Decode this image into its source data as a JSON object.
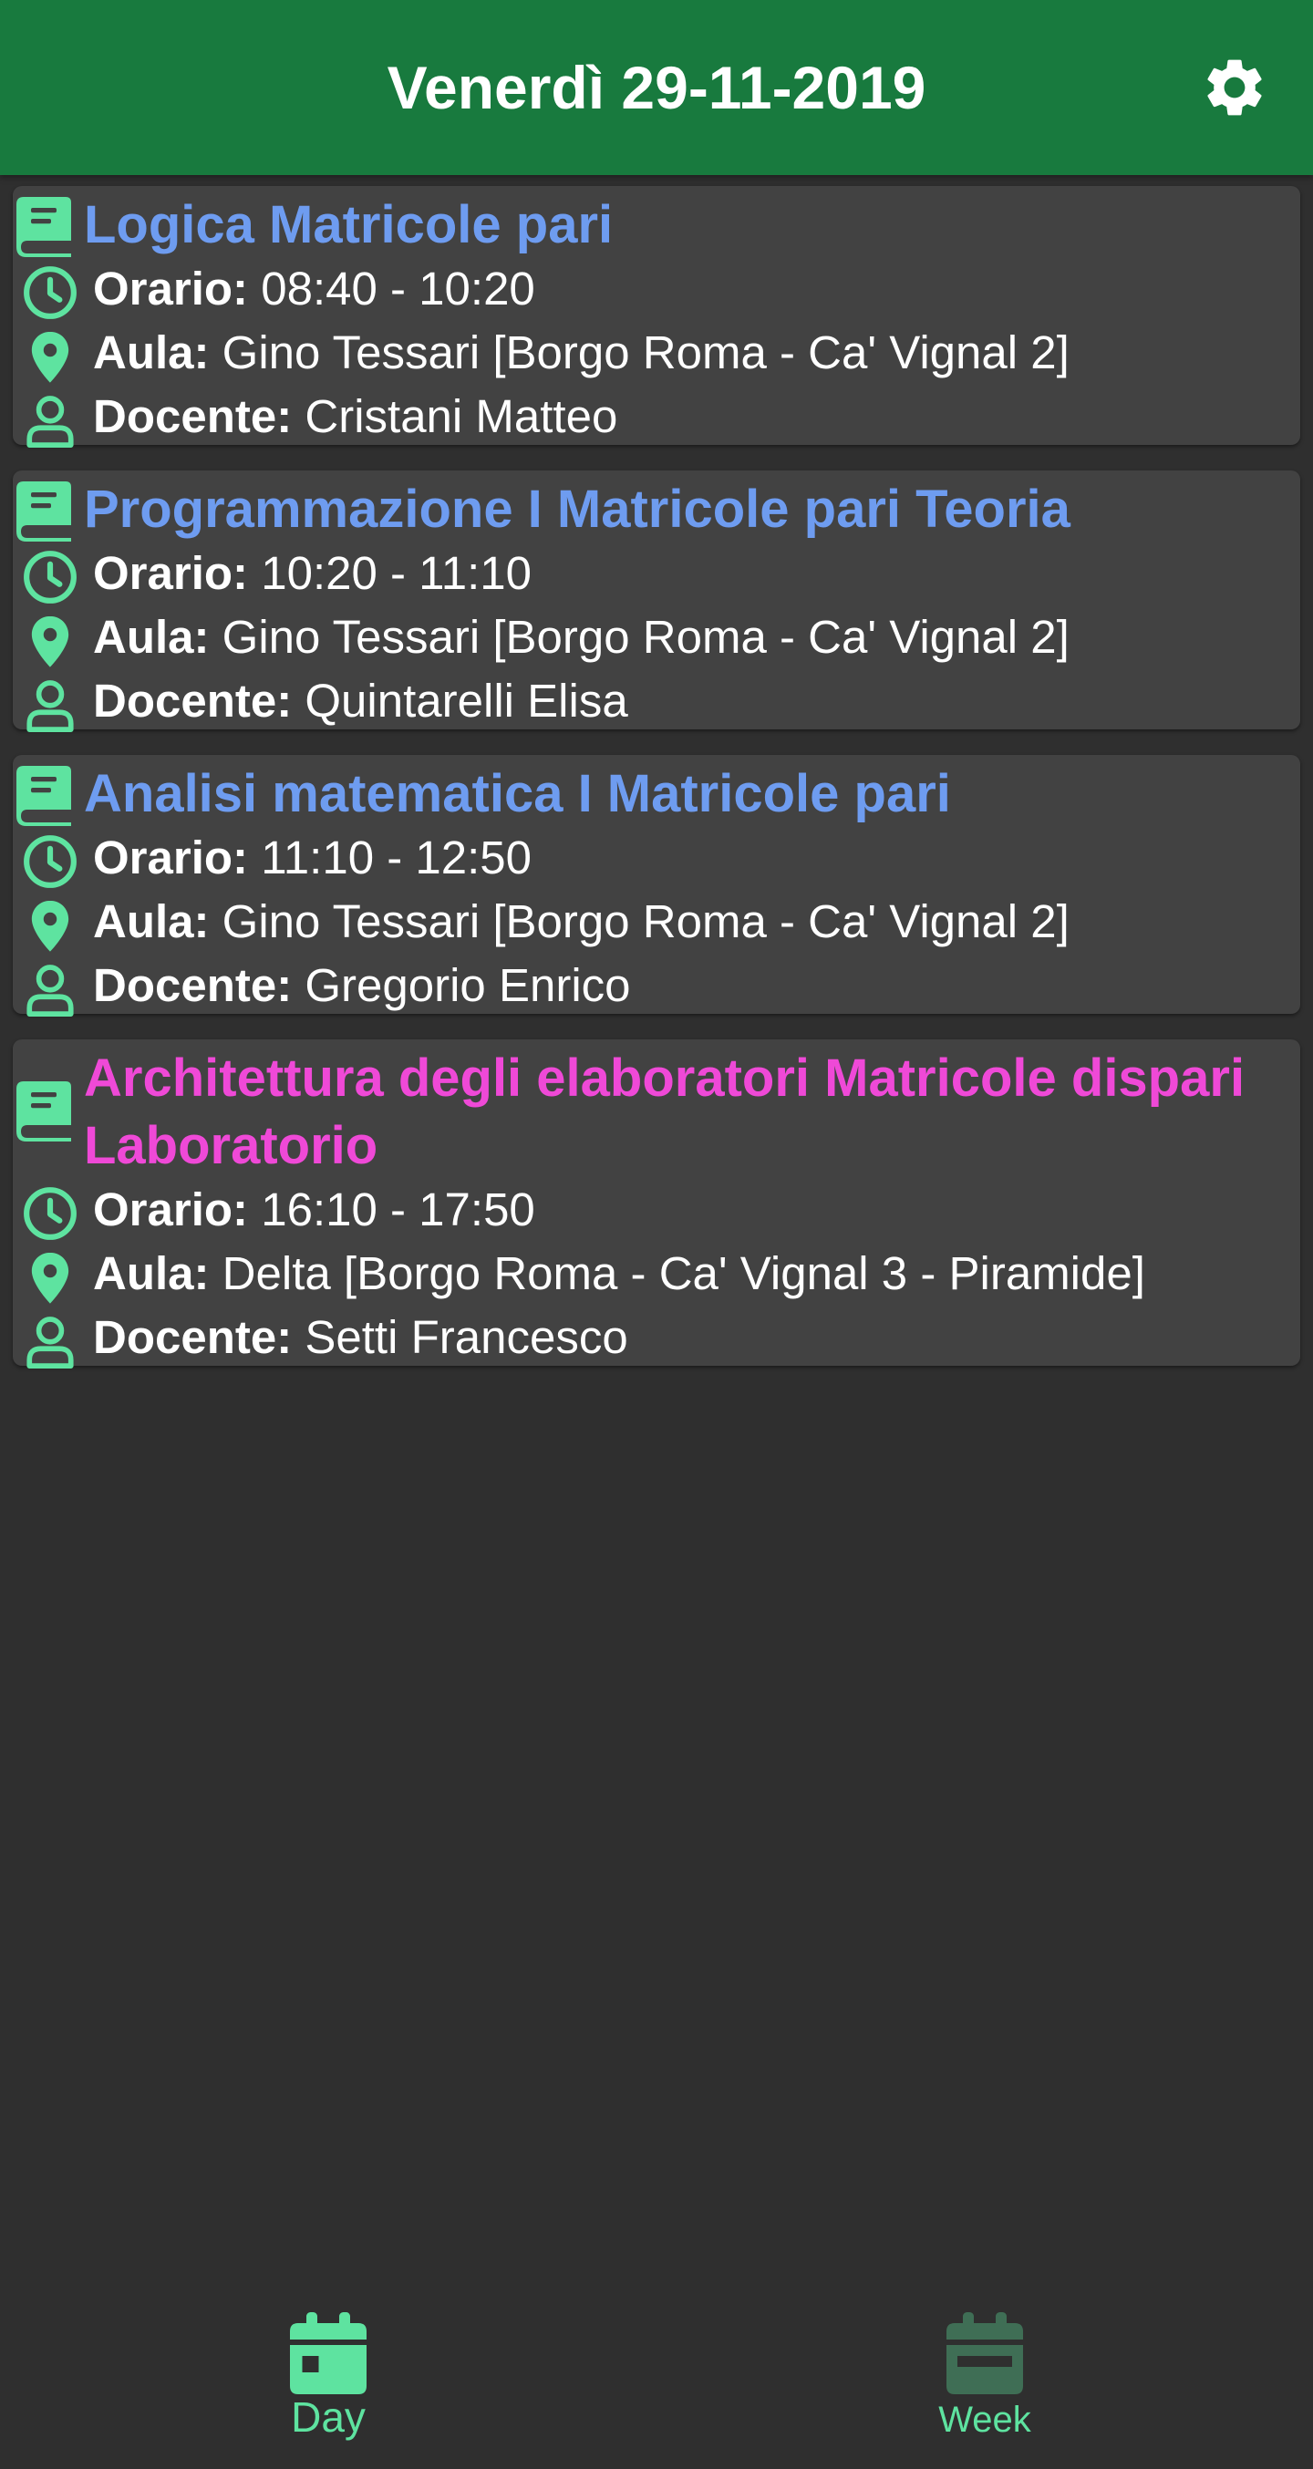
{
  "header": {
    "title": "Venerdì 29-11-2019",
    "settings_icon": "gear-icon"
  },
  "colors": {
    "appbar": "#187a3e",
    "background": "#2f2f2f",
    "card": "#424242",
    "icon": "#5ee3a0",
    "title_lesson": "#6e9cf0",
    "title_lab": "#ef49d7"
  },
  "labels": {
    "time": "Orario:",
    "room": "Aula:",
    "teacher": "Docente:"
  },
  "lessons": [
    {
      "title": "Logica Matricole pari",
      "time": "08:40 - 10:20",
      "room": "Gino Tessari [Borgo Roma - Ca' Vignal 2]",
      "teacher": "Cristani Matteo"
    },
    {
      "title": "Programmazione I Matricole pari Teoria",
      "time": "10:20 - 11:10",
      "room": "Gino Tessari [Borgo Roma - Ca' Vignal 2]",
      "teacher": "Quintarelli Elisa"
    },
    {
      "title": "Analisi matematica I Matricole pari",
      "time": "11:10 - 12:50",
      "room": "Gino Tessari [Borgo Roma - Ca' Vignal 2]",
      "teacher": "Gregorio Enrico"
    },
    {
      "title_line1": "Architettura degli elaboratori Matricole dispari",
      "title_line2": "Laboratorio",
      "time": "16:10 - 17:50",
      "room": "Delta [Borgo Roma - Ca' Vignal 3 - Piramide]",
      "teacher": "Setti Francesco"
    }
  ],
  "bottom_nav": {
    "day_label": "Day",
    "week_label": "Week",
    "active": "Day"
  }
}
